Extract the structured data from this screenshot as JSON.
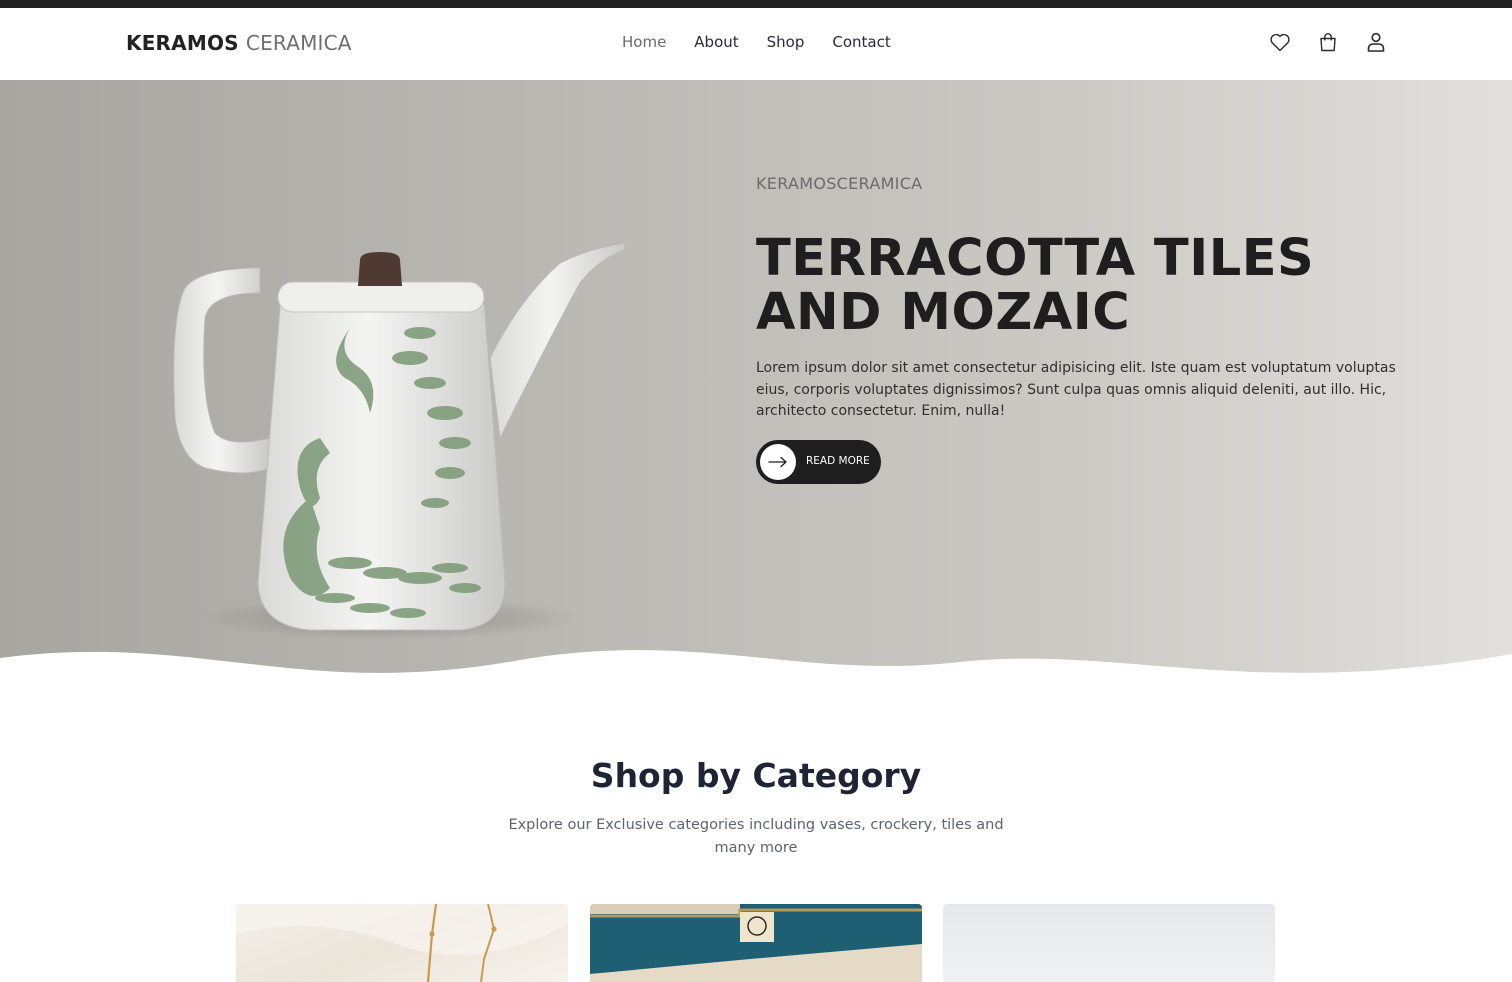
{
  "brand": {
    "name_part1": "KERAMOS",
    "name_part2": "CERAMICA"
  },
  "nav": {
    "links": [
      {
        "label": "Home"
      },
      {
        "label": "About"
      },
      {
        "label": "Shop"
      },
      {
        "label": "Contact"
      }
    ],
    "icons": [
      "heart-icon",
      "shopping-bag-icon",
      "user-icon"
    ]
  },
  "hero": {
    "eyebrow": "KERAMOSCERAMICA",
    "title": "TERRACOTTA TILES AND MOZAIC",
    "text": "Lorem ipsum dolor sit amet consectetur adipisicing elit. Iste quam est voluptatum voluptas eius, corporis voluptates dignissimos? Sunt culpa quas omnis aliquid deleniti, aut illo. Hic, architecto consectetur. Enim, nulla!",
    "button_label": "READ MORE"
  },
  "categories": {
    "title": "Shop by Category",
    "subtitle": "Explore our Exclusive categories including vases, crockery, tiles and many more"
  },
  "colors": {
    "dark": "#1e1e1e",
    "hero_left": "#a8a6a1",
    "hero_right": "#e2e0dc",
    "leaf_green": "#7d9a78"
  }
}
